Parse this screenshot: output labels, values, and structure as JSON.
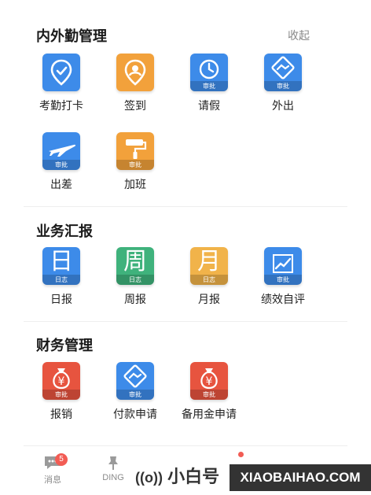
{
  "sections": {
    "attendance": {
      "title": "内外勤管理",
      "collapse_label": "收起",
      "items": [
        {
          "label": "考勤打卡",
          "badge": ""
        },
        {
          "label": "签到",
          "badge": ""
        },
        {
          "label": "请假",
          "badge": "审批"
        },
        {
          "label": "外出",
          "badge": "审批"
        },
        {
          "label": "出差",
          "badge": "审批"
        },
        {
          "label": "加班",
          "badge": "审批"
        }
      ]
    },
    "business": {
      "title": "业务汇报",
      "items": [
        {
          "label": "日报",
          "glyph": "日",
          "badge": "日志"
        },
        {
          "label": "周报",
          "glyph": "周",
          "badge": "日志"
        },
        {
          "label": "月报",
          "glyph": "月",
          "badge": "日志"
        },
        {
          "label": "绩效自评",
          "badge": "审批"
        }
      ]
    },
    "finance": {
      "title": "财务管理",
      "items": [
        {
          "label": "报销",
          "glyph": "¥",
          "badge": "审批"
        },
        {
          "label": "付款申请",
          "badge": "审批"
        },
        {
          "label": "备用金申请",
          "glyph": "¥",
          "badge": "审批"
        }
      ]
    }
  },
  "tabbar": {
    "messages": {
      "label": "消息",
      "count": "5"
    },
    "ding": {
      "label": "DING"
    }
  },
  "watermark": {
    "text": "小白号",
    "site": "XIAOBAIHAO.COM"
  },
  "colors": {
    "blue": "#3d8be9",
    "orange": "#f2a13b",
    "teal": "#3fb27c",
    "amber": "#f1b34a",
    "red": "#e7543f",
    "badge_red": "#f25c54"
  }
}
